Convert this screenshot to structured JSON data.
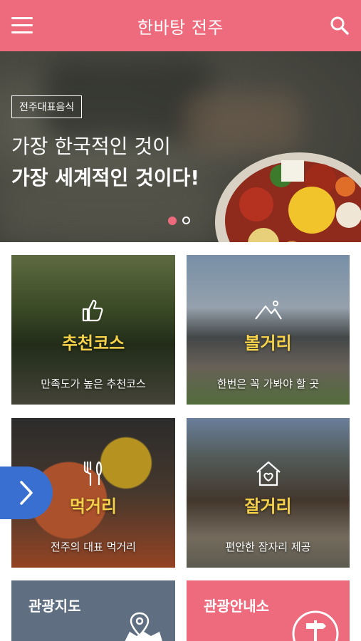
{
  "header": {
    "title": "한바탕 전주"
  },
  "hero": {
    "tag": "전주대표음식",
    "line1": "가장 한국적인 것이",
    "line2": "가장 세계적인 것이다!",
    "slides": 2,
    "active_slide": 1
  },
  "tiles": [
    {
      "label": "추천코스",
      "sub": "만족도가 높은 추천코스",
      "icon": "thumbs-up-icon"
    },
    {
      "label": "볼거리",
      "sub": "한번은 꼭 가봐야 할 곳",
      "icon": "mountain-icon"
    },
    {
      "label": "먹거리",
      "sub": "전주의 대표 먹거리",
      "icon": "fork-knife-icon"
    },
    {
      "label": "잘거리",
      "sub": "편안한 잠자리 제공",
      "icon": "house-heart-icon"
    }
  ],
  "bottom_tiles": [
    {
      "label": "관광지도",
      "icon": "map-pin-icon"
    },
    {
      "label": "관광안내소",
      "icon": "signpost-icon"
    }
  ],
  "colors": {
    "brand": "#ee6b7e",
    "accent": "#3a6fd2",
    "tile_label": "#f5d24a",
    "map_tile": "#5f6e80"
  }
}
